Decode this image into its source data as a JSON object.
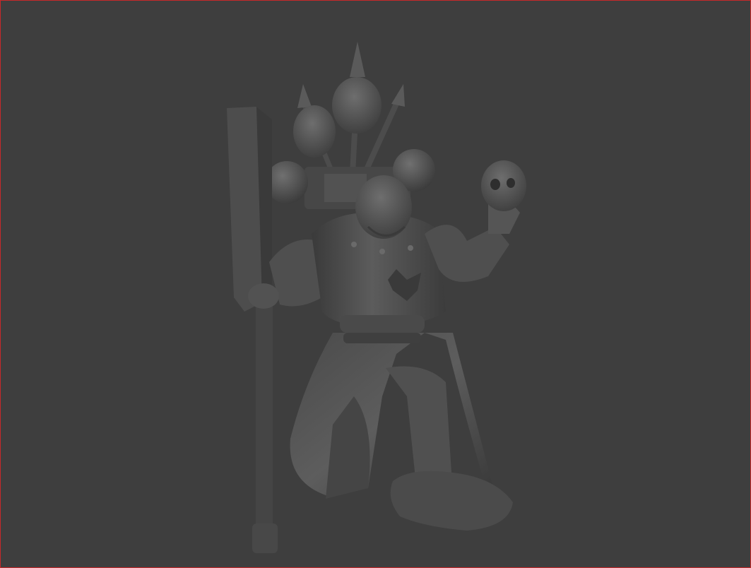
{
  "viewport": {
    "label": "",
    "background": "#3e3e3e",
    "border_color": "#c8282a",
    "active": true
  },
  "model": {
    "icon": "sculpted-miniature-model",
    "shading": "matcap-grey",
    "base_color": "#555555",
    "shadow_color": "#2f2f2f",
    "highlight_color": "#7a7a7a"
  }
}
